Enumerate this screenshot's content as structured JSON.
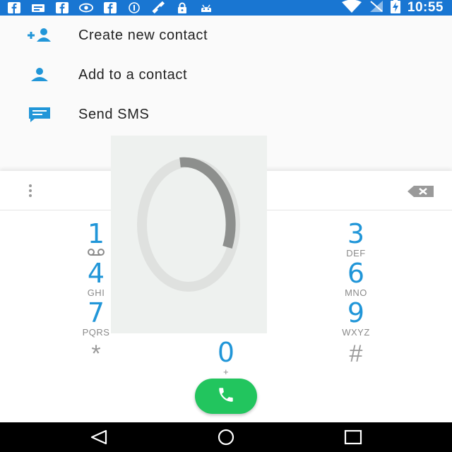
{
  "status_bar": {
    "background_color": "#1976d2",
    "left_icons": [
      "facebook-icon",
      "message-icon",
      "facebook-icon",
      "eye-icon",
      "facebook-icon",
      "info-icon",
      "satellite-icon",
      "lock-icon",
      "android-icon"
    ],
    "right_icons": [
      "wifi-icon",
      "signal-icon",
      "battery-charging-icon"
    ],
    "time": "10:55"
  },
  "menu": {
    "items": [
      {
        "label": "Create new contact",
        "icon": "add-contact-icon"
      },
      {
        "label": "Add to a contact",
        "icon": "person-icon"
      },
      {
        "label": "Send SMS",
        "icon": "sms-icon"
      }
    ]
  },
  "dialpad": {
    "accent_color": "#2196d8",
    "keys": [
      {
        "digit": "1",
        "letters": ""
      },
      {
        "digit": "3",
        "letters": "DEF"
      },
      {
        "digit": "4",
        "letters": "GHI"
      },
      {
        "digit": "6",
        "letters": "MNO"
      },
      {
        "digit": "7",
        "letters": "PQRS"
      },
      {
        "digit": "9",
        "letters": "WXYZ"
      },
      {
        "digit": "0",
        "letters": "+"
      }
    ],
    "star": "*",
    "hash": "#",
    "call_button_color": "#22c55e"
  },
  "loading": {
    "icon": "loading-spinner-icon"
  },
  "nav_bar": {
    "buttons": [
      "back-icon",
      "home-icon",
      "recents-icon"
    ]
  }
}
